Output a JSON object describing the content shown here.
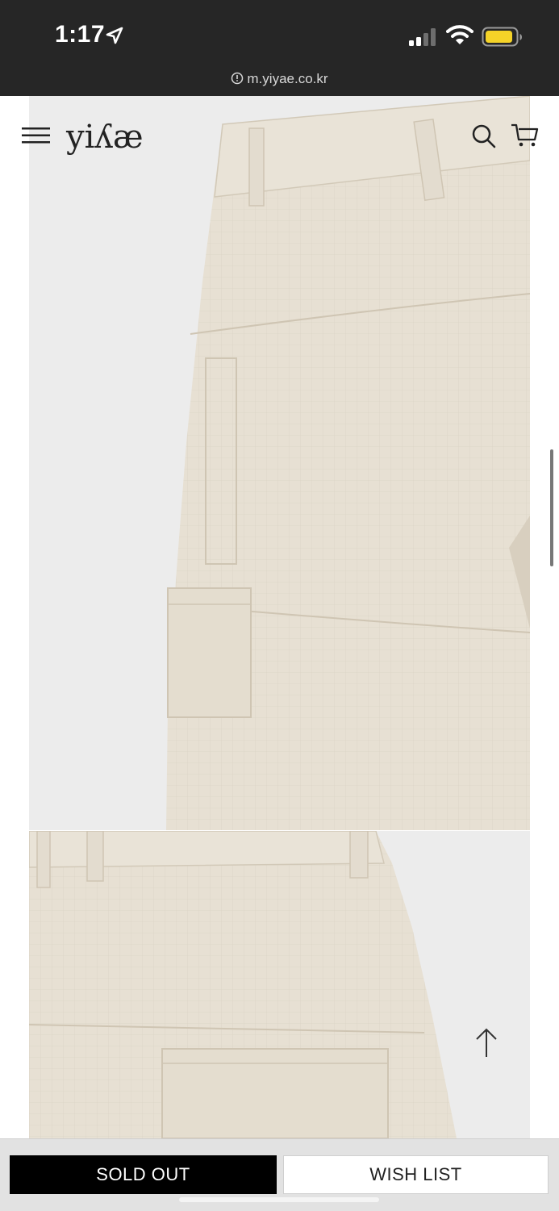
{
  "status_bar": {
    "time": "1:17",
    "url": "m.yiyae.co.kr"
  },
  "header": {
    "logo": "yiʎæ"
  },
  "product": {
    "primary_status_label": "SOLD OUT",
    "wishlist_label": "WISH LIST"
  },
  "colors": {
    "status_bar_bg": "#262626",
    "battery_fill": "#f5d328",
    "photo_bg": "#ececec",
    "fabric": "#e7e0d3",
    "sold_out_bg": "#000000"
  }
}
